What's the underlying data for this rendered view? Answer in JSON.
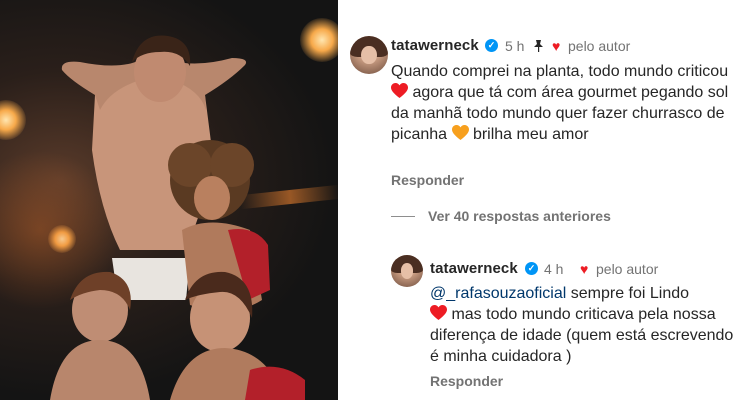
{
  "comment": {
    "username": "tatawerneck",
    "time": "5 h",
    "liked_by_author": "pelo autor",
    "text_parts": [
      "Quando comprei na planta, todo mundo criticou ",
      " agora que tá com área gourmet pegando sol da manhã todo mundo quer fazer churrasco de picanha ",
      " brilha meu amor"
    ],
    "reply_label": "Responder"
  },
  "view_more": "Ver 40 respostas anteriores",
  "reply": {
    "username": "tatawerneck",
    "time": "4 h",
    "liked_by_author": "pelo autor",
    "mention": "@_rafasouzaoficial",
    "text_after_mention": " sempre foi Lindo",
    "text_rest": " mas todo mundo criticava pela nossa diferença de idade (quem está escrevendo é minha cuidadora )",
    "reply_label": "Responder"
  },
  "colors": {
    "heart_red": "#ed1c24",
    "heart_orange": "#f7a01e",
    "verified_blue": "#0095f6",
    "mention_blue": "#00376b",
    "muted_gray": "#737373"
  },
  "icons": [
    "verified-icon",
    "pin-icon",
    "heart-icon",
    "red-heart-emoji",
    "orange-heart-emoji"
  ]
}
